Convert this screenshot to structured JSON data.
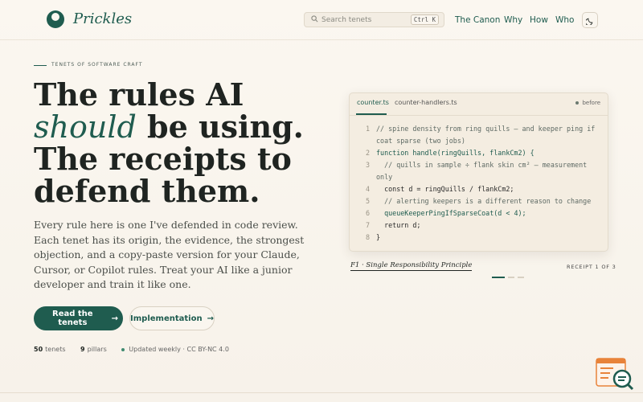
{
  "brand": {
    "name": "Prickles"
  },
  "search": {
    "placeholder": "Search tenets",
    "shortcut": "Ctrl K"
  },
  "nav": {
    "links": [
      "The Canon",
      "Why",
      "How",
      "Who"
    ]
  },
  "hero": {
    "eyebrow": "TENETS OF SOFTWARE CRAFT",
    "headline": {
      "line1": "The rules AI",
      "emphasis": "should",
      "line2_rest": " be using.",
      "line3": "The receipts to",
      "line4": "defend them."
    },
    "lede": "Every rule here is one I've defended in code review. Each tenet has its origin, the evidence, the strongest objection, and a copy-paste version for your Claude, Cursor, or Copilot rules. Treat your AI like a junior developer and train it like one.",
    "primary_cta": "Read the tenets",
    "secondary_cta": "Implementation",
    "arrow": "→",
    "stats": [
      {
        "value": "50",
        "label": "tenets"
      },
      {
        "value": "9",
        "label": "pillars"
      }
    ],
    "status": "Updated weekly · CC BY-NC 4.0"
  },
  "code_panel": {
    "tabs": [
      "counter.ts",
      "counter-handlers.ts"
    ],
    "state_label": "before",
    "lines": [
      {
        "n": "1",
        "text": "// spine density from ring quills — and keeper ping if coat sparse (two jobs)"
      },
      {
        "n": "2",
        "text": "function handle(ringQuills, flankCm2) {"
      },
      {
        "n": "3",
        "text": "  // quills in sample ÷ flank skin cm² — measurement only"
      },
      {
        "n": "4",
        "text": "  const d = ringQuills / flankCm2;"
      },
      {
        "n": "5",
        "text": "  // alerting keepers is a different reason to change"
      },
      {
        "n": "6",
        "text": "  queueKeeperPingIfSparseCoat(d < 4);"
      },
      {
        "n": "7",
        "text": "  return d;"
      },
      {
        "n": "8",
        "text": "}"
      }
    ],
    "caption": "F1 · Single Responsibility Principle",
    "receipt_label": "RECEIPT 1 OF 3",
    "current_receipt": 1,
    "total_receipts": 3
  },
  "icons": {
    "search": "search-icon",
    "theme": "moon-icon",
    "widget": "document-search-icon"
  },
  "colors": {
    "accent": "#1f5c4f",
    "background": "#fbf7f0",
    "widget": "#e8833a"
  }
}
